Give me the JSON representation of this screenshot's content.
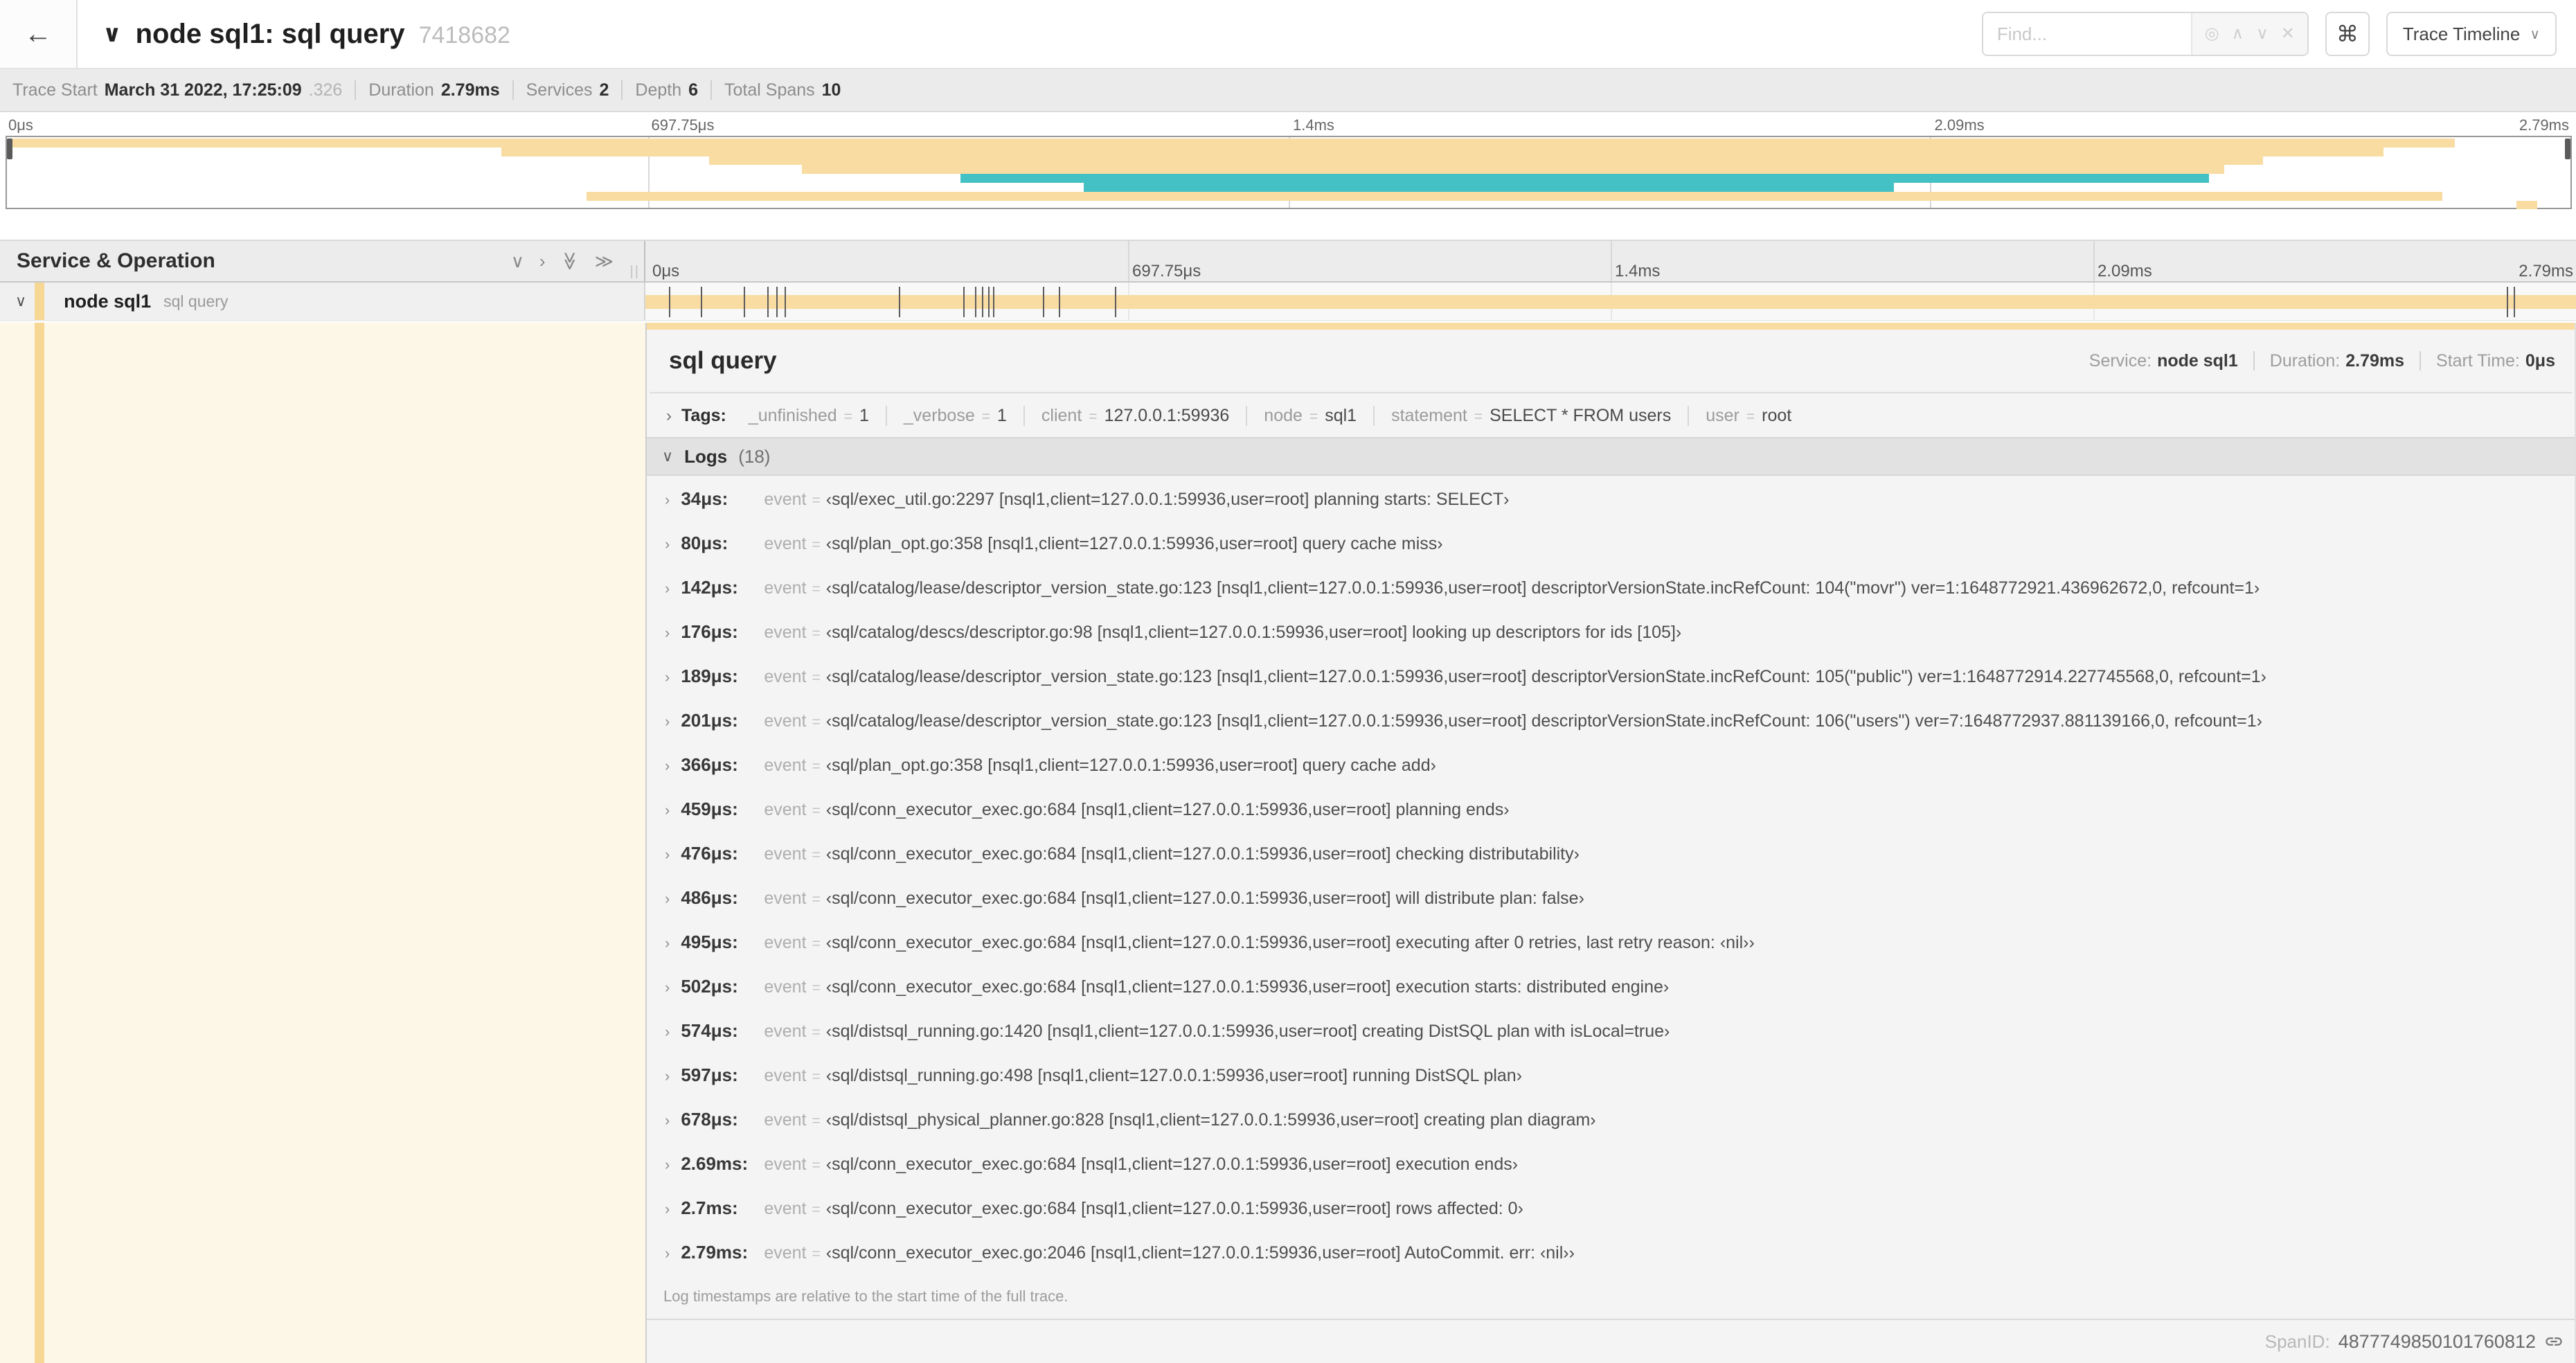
{
  "header": {
    "title": "node sql1: sql query",
    "trace_id": "7418682",
    "find_placeholder": "Find...",
    "view_button": "Trace Timeline"
  },
  "icons": {
    "back": "←",
    "collapse_caret": "∨",
    "locate": "◎",
    "prev": "∧",
    "next": "∨",
    "clear": "✕",
    "keyboard": "⌘",
    "caret_down": "∨",
    "chevron_right": "›",
    "double_chevron": "≫",
    "grip": "||"
  },
  "stats": [
    {
      "label": "Trace Start",
      "value": "March 31 2022, 17:25:09",
      "suffix": ".326"
    },
    {
      "label": "Duration",
      "value": "2.79ms",
      "suffix": ""
    },
    {
      "label": "Services",
      "value": "2",
      "suffix": ""
    },
    {
      "label": "Depth",
      "value": "6",
      "suffix": ""
    },
    {
      "label": "Total Spans",
      "value": "10",
      "suffix": ""
    }
  ],
  "ruler": [
    "0μs",
    "697.75μs",
    "1.4ms",
    "2.09ms",
    "2.79ms"
  ],
  "minimap": {
    "rows": [
      {
        "l": 0,
        "r": 95.5,
        "c": "tan"
      },
      {
        "l": 19.3,
        "r": 92.7,
        "c": "tan"
      },
      {
        "l": 27.4,
        "r": 88.0,
        "c": "tan"
      },
      {
        "l": 31.0,
        "r": 86.5,
        "c": "tan"
      },
      {
        "l": 37.2,
        "r": 85.9,
        "c": "teal"
      },
      {
        "l": 42.0,
        "r": 73.6,
        "c": "teal"
      },
      {
        "l": 22.6,
        "r": 95.0,
        "c": "tan"
      },
      {
        "l": 97.9,
        "r": 98.7,
        "c": "tan"
      }
    ]
  },
  "left_panel": {
    "header": "Service & Operation",
    "service": "node sql1",
    "operation": "sql query"
  },
  "span": {
    "total_us": 2790,
    "log_marks_us": [
      34,
      80,
      142,
      176,
      189,
      201,
      366,
      459,
      476,
      486,
      495,
      502,
      574,
      597,
      678,
      2690,
      2700
    ]
  },
  "detail": {
    "title": "sql query",
    "service_label": "Service:",
    "service": "node sql1",
    "duration_label": "Duration:",
    "duration": "2.79ms",
    "start_label": "Start Time:",
    "start": "0μs",
    "tags_label": "Tags:",
    "tags": [
      {
        "k": "_unfinished",
        "v": "1"
      },
      {
        "k": "_verbose",
        "v": "1"
      },
      {
        "k": "client",
        "v": "127.0.0.1:59936"
      },
      {
        "k": "node",
        "v": "sql1"
      },
      {
        "k": "statement",
        "v": "SELECT * FROM users"
      },
      {
        "k": "user",
        "v": "root"
      }
    ],
    "logs_label": "Logs",
    "logs_count": "(18)",
    "log_key": "event",
    "logs": [
      {
        "t": "34μs:",
        "v": "‹sql/exec_util.go:2297 [nsql1,client=127.0.0.1:59936,user=root] planning starts: SELECT›"
      },
      {
        "t": "80μs:",
        "v": "‹sql/plan_opt.go:358 [nsql1,client=127.0.0.1:59936,user=root] query cache miss›"
      },
      {
        "t": "142μs:",
        "v": "‹sql/catalog/lease/descriptor_version_state.go:123 [nsql1,client=127.0.0.1:59936,user=root] descriptorVersionState.incRefCount: 104(\"movr\") ver=1:1648772921.436962672,0, refcount=1›"
      },
      {
        "t": "176μs:",
        "v": "‹sql/catalog/descs/descriptor.go:98 [nsql1,client=127.0.0.1:59936,user=root] looking up descriptors for ids [105]›"
      },
      {
        "t": "189μs:",
        "v": "‹sql/catalog/lease/descriptor_version_state.go:123 [nsql1,client=127.0.0.1:59936,user=root] descriptorVersionState.incRefCount: 105(\"public\") ver=1:1648772914.227745568,0, refcount=1›"
      },
      {
        "t": "201μs:",
        "v": "‹sql/catalog/lease/descriptor_version_state.go:123 [nsql1,client=127.0.0.1:59936,user=root] descriptorVersionState.incRefCount: 106(\"users\") ver=7:1648772937.881139166,0, refcount=1›"
      },
      {
        "t": "366μs:",
        "v": "‹sql/plan_opt.go:358 [nsql1,client=127.0.0.1:59936,user=root] query cache add›"
      },
      {
        "t": "459μs:",
        "v": "‹sql/conn_executor_exec.go:684 [nsql1,client=127.0.0.1:59936,user=root] planning ends›"
      },
      {
        "t": "476μs:",
        "v": "‹sql/conn_executor_exec.go:684 [nsql1,client=127.0.0.1:59936,user=root] checking distributability›"
      },
      {
        "t": "486μs:",
        "v": "‹sql/conn_executor_exec.go:684 [nsql1,client=127.0.0.1:59936,user=root] will distribute plan: false›"
      },
      {
        "t": "495μs:",
        "v": "‹sql/conn_executor_exec.go:684 [nsql1,client=127.0.0.1:59936,user=root] executing after 0 retries, last retry reason: ‹nil››"
      },
      {
        "t": "502μs:",
        "v": "‹sql/conn_executor_exec.go:684 [nsql1,client=127.0.0.1:59936,user=root] execution starts: distributed engine›"
      },
      {
        "t": "574μs:",
        "v": "‹sql/distsql_running.go:1420 [nsql1,client=127.0.0.1:59936,user=root] creating DistSQL plan with isLocal=true›"
      },
      {
        "t": "597μs:",
        "v": "‹sql/distsql_running.go:498 [nsql1,client=127.0.0.1:59936,user=root] running DistSQL plan›"
      },
      {
        "t": "678μs:",
        "v": "‹sql/distsql_physical_planner.go:828 [nsql1,client=127.0.0.1:59936,user=root] creating plan diagram›"
      },
      {
        "t": "2.69ms:",
        "v": "‹sql/conn_executor_exec.go:684 [nsql1,client=127.0.0.1:59936,user=root] execution ends›"
      },
      {
        "t": "2.7ms:",
        "v": "‹sql/conn_executor_exec.go:684 [nsql1,client=127.0.0.1:59936,user=root] rows affected: 0›"
      },
      {
        "t": "2.79ms:",
        "v": "‹sql/conn_executor_exec.go:2046 [nsql1,client=127.0.0.1:59936,user=root] AutoCommit. err: ‹nil››"
      }
    ],
    "log_note": "Log timestamps are relative to the start time of the full trace.",
    "span_id_label": "SpanID:",
    "span_id": "4877749850101760812"
  }
}
